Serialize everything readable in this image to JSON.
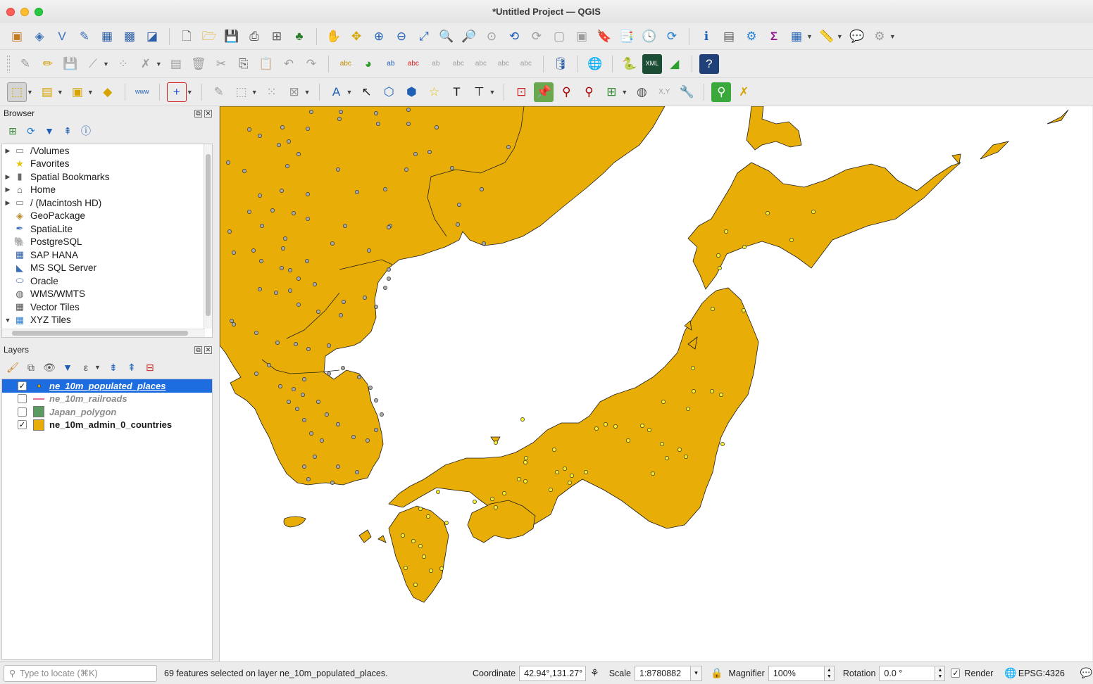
{
  "window": {
    "title": "*Untitled Project — QGIS"
  },
  "toolbars": {
    "row1": [
      "open-data-source-manager",
      "new-geopackage-layer",
      "new-shapefile-layer",
      "digitize-icon",
      "add-raster-icon",
      "mesh-icon",
      "virtual-layer-icon",
      "new-project",
      "open-project",
      "save-project",
      "print-layout",
      "layout-manager",
      "style-manager",
      "pan-map",
      "pan-to-selection",
      "zoom-in",
      "zoom-out",
      "zoom-full",
      "zoom-to-selection",
      "zoom-to-layer",
      "zoom-native",
      "zoom-last",
      "zoom-next",
      "new-map-view",
      "new-3d-view",
      "new-bookmark",
      "show-bookmarks",
      "temporal-controller",
      "refresh",
      "identify-features",
      "open-attribute-table",
      "toolbox",
      "statistics",
      "open-table",
      "measure",
      "map-tips",
      "settings"
    ],
    "row2": [
      "toggle-editing",
      "current-edits",
      "save-edits",
      "digitize-line",
      "vertex-tool",
      "modify-attributes",
      "delete-selected",
      "cut-features",
      "copy-features",
      "paste-features",
      "undo",
      "redo",
      "label-tool",
      "diagram-tool",
      "pin-labels",
      "show-labels",
      "move-label",
      "rotate-label",
      "change-label",
      "database",
      "mapserver",
      "python",
      "xml-tool",
      "profile-tool",
      "help"
    ],
    "row3": [
      "select-features",
      "select-by-value",
      "deselect",
      "select-location",
      "web-tool",
      "add-point",
      "annotation-tools"
    ]
  },
  "browser": {
    "title": "Browser",
    "items": [
      {
        "label": "/Volumes",
        "expand": "▶",
        "icon": "folder-icon"
      },
      {
        "label": "Favorites",
        "expand": "",
        "icon": "star-icon"
      },
      {
        "label": "Spatial Bookmarks",
        "expand": "▶",
        "icon": "bookmark-icon"
      },
      {
        "label": "Home",
        "expand": "▶",
        "icon": "home-icon"
      },
      {
        "label": "/ (Macintosh HD)",
        "expand": "▶",
        "icon": "folder-icon"
      },
      {
        "label": "GeoPackage",
        "expand": "",
        "icon": "geopackage-icon"
      },
      {
        "label": "SpatiaLite",
        "expand": "",
        "icon": "spatialite-icon"
      },
      {
        "label": "PostgreSQL",
        "expand": "",
        "icon": "postgresql-icon"
      },
      {
        "label": "SAP HANA",
        "expand": "",
        "icon": "sap-hana-icon"
      },
      {
        "label": "MS SQL Server",
        "expand": "",
        "icon": "mssql-icon"
      },
      {
        "label": "Oracle",
        "expand": "",
        "icon": "oracle-icon"
      },
      {
        "label": "WMS/WMTS",
        "expand": "",
        "icon": "wms-icon"
      },
      {
        "label": "Vector Tiles",
        "expand": "",
        "icon": "vector-tiles-icon"
      },
      {
        "label": "XYZ Tiles",
        "expand": "▼",
        "icon": "xyz-tiles-icon"
      }
    ]
  },
  "layers": {
    "title": "Layers",
    "items": [
      {
        "name": "ne_10m_populated_places",
        "checked": true,
        "selected": true,
        "symbol": "point",
        "color": "#f2b705"
      },
      {
        "name": "ne_10m_railroads",
        "checked": false,
        "selected": false,
        "symbol": "line",
        "color": "#e0709a"
      },
      {
        "name": "Japan_polygon",
        "checked": false,
        "selected": false,
        "symbol": "fill",
        "color": "#5c9b62"
      },
      {
        "name": "ne_10m_admin_0_countries",
        "checked": true,
        "selected": false,
        "symbol": "fill",
        "color": "#e8ad0a"
      }
    ]
  },
  "map": {
    "land_color": "#e8ad06",
    "selected_point_color": "#f5ef34",
    "unselected_point_color": "#a9a9a9"
  },
  "status": {
    "locate_placeholder": "Type to locate (⌘K)",
    "message": "69 features selected on layer ne_10m_populated_places.",
    "coordinate_label": "Coordinate",
    "coordinate_value": "42.94°,131.27°",
    "scale_label": "Scale",
    "scale_value": "1:8780882",
    "magnifier_label": "Magnifier",
    "magnifier_value": "100%",
    "rotation_label": "Rotation",
    "rotation_value": "0.0 °",
    "render_label": "Render",
    "render_checked": true,
    "crs": "EPSG:4326"
  }
}
